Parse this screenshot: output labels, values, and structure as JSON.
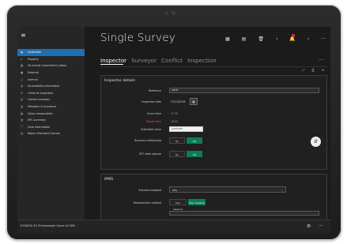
{
  "app": {
    "title": "Single Survey"
  },
  "toolbar": {
    "icons": [
      "grid-icon",
      "list-icon",
      "trash-icon",
      "back-icon",
      "notification-icon",
      "forward-icon",
      "more-icon"
    ],
    "glyphs": [
      "▦",
      "▤",
      "🗑",
      "‹",
      "🔔",
      "›",
      "···"
    ]
  },
  "tabs": [
    {
      "label": "Inspector",
      "active": true
    },
    {
      "label": "Surveyor",
      "active": false
    },
    {
      "label": "Conflict",
      "active": false
    },
    {
      "label": "Inspection",
      "active": false
    }
  ],
  "more_glyph": "···",
  "menu_glyph": "≡",
  "sidebar": {
    "items": [
      {
        "label": "Inspection",
        "glyph": "▤",
        "active": true
      },
      {
        "label": "Property",
        "glyph": "⌂"
      },
      {
        "label": "Structural movement & damp",
        "glyph": "▦"
      },
      {
        "label": "External",
        "glyph": "▣"
      },
      {
        "label": "Internal",
        "glyph": "▢"
      },
      {
        "label": "Accessibility information",
        "glyph": "◍"
      },
      {
        "label": "Limits to inspection",
        "glyph": "⊘"
      },
      {
        "label": "Overall summary",
        "glyph": "▤"
      },
      {
        "label": "Valuation & Insurance",
        "glyph": "▥"
      },
      {
        "label": "Value comparables",
        "glyph": "▦"
      },
      {
        "label": "EPC summary",
        "glyph": "▧"
      },
      {
        "label": "Case information",
        "glyph": "ⓘ"
      },
      {
        "label": "Report Standard Clauses",
        "glyph": "▤"
      }
    ]
  },
  "sub_icons": [
    "⤢",
    "⎙",
    "⟲"
  ],
  "inspector_details": {
    "title": "Inspector details",
    "reference_label": "Reference",
    "reference_value": "SRCM",
    "inspection_date_label": "Inspection date",
    "inspection_date_value": "27/11/2018",
    "calendar_glyph": "▦",
    "arrive_time_label": "Arrive time",
    "arrive_time_value": "17:30",
    "depart_time_label": "Depart time",
    "depart_time_value": "18:05",
    "estimated_value_label": "Estimated value",
    "estimated_value_value": "£195,000",
    "business_relationship_label": "Business relationship",
    "business_relationship_options": [
      "No",
      "Yes"
    ],
    "epc_data_capture_label": "EPC data capture",
    "epc_data_capture_options": [
      "No",
      "Yes"
    ]
  },
  "ipms": {
    "title": "IPMS",
    "standard_label": "Standard adopted",
    "standard_value": "GEA",
    "measurement_label": "Measurement method",
    "measurement_options": [
      "User measure",
      "Plan measure"
    ]
  },
  "footer": {
    "address": "87B/87A/ R1 Primesample Grove A2 9BE",
    "icons": [
      "settings-icon",
      "more-icon"
    ],
    "glyphs": [
      "⚙",
      "···"
    ]
  },
  "scroll_glyph": "⇵",
  "colors": {
    "accent": "#1f6fb5",
    "toggle_on": "#0f7b5a",
    "required": "#e8554f"
  }
}
